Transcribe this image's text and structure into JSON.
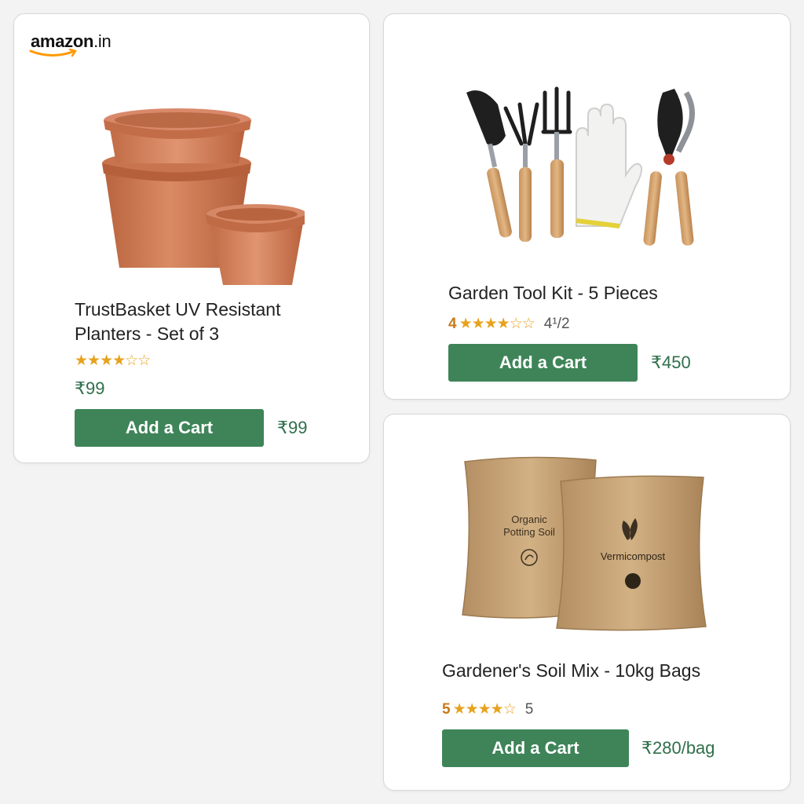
{
  "store": {
    "logo_main": "amazon",
    "logo_suffix": ".in"
  },
  "products": [
    {
      "title_line1": "TrustBasket UV Resistant",
      "title_line2": "Planters - Set of 3",
      "rating_lead": "",
      "stars": "★★★★☆☆",
      "rating_count": "",
      "list_price": "₹99",
      "button_label": "Add a Cart",
      "price": "₹99",
      "image": "terracotta-planters-image"
    },
    {
      "title_line1": "Garden Tool Kit - 5 Pieces",
      "title_line2": "",
      "rating_lead": "4",
      "stars": "★★★★☆☆",
      "rating_count": "4¹/2",
      "list_price": "",
      "button_label": "Add a Cart",
      "price": "₹450",
      "image": "garden-tools-image"
    },
    {
      "title_line1": "Gardener's Soil Mix - 10kg Bags",
      "title_line2": "",
      "rating_lead": "5",
      "stars": "★★★★☆",
      "rating_count": "5",
      "list_price": "",
      "button_label": "Add a Cart",
      "price": "₹280/bag",
      "image": "soil-bags-image",
      "bag1_line1": "Organic",
      "bag1_line2": "Potting Soil",
      "bag2_label": "Vermicompost"
    }
  ],
  "colors": {
    "button": "#3e8458",
    "price": "#2f6f4a",
    "star": "#e7a21d",
    "accent_orange": "#ff9900"
  }
}
